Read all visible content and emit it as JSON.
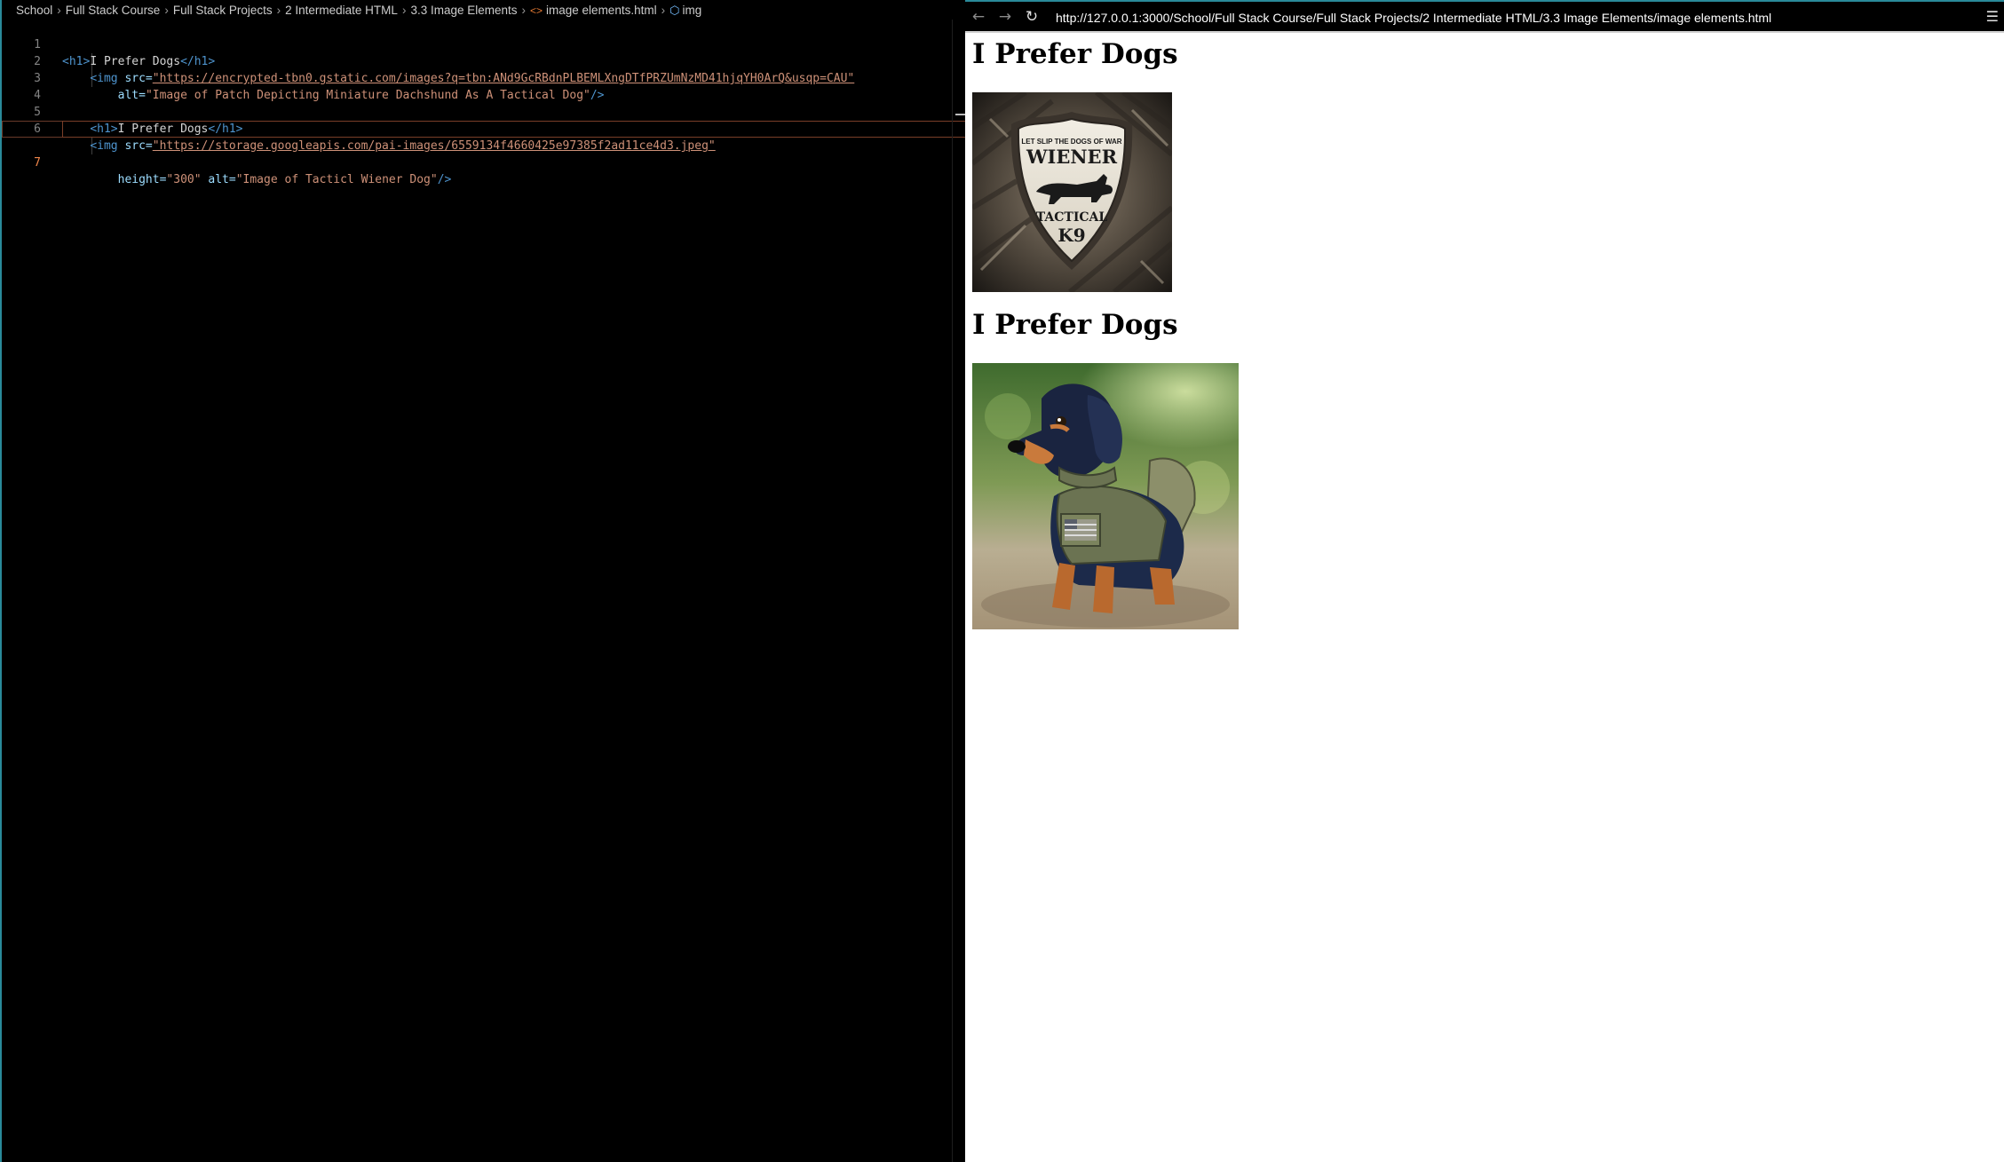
{
  "editor": {
    "breadcrumb": [
      "School",
      "Full Stack Course",
      "Full Stack Projects",
      "2 Intermediate HTML",
      "3.3 Image Elements"
    ],
    "breadcrumb_file": "image elements.html",
    "breadcrumb_symbol": "img",
    "active_line": 7,
    "lines": [
      {
        "n": "1"
      },
      {
        "n": "2"
      },
      {
        "n": "3"
      },
      {
        "n": "4"
      },
      {
        "n": "5"
      },
      {
        "n": "6"
      },
      {
        "n": "7"
      }
    ],
    "code": {
      "l1_open": "<h1>",
      "l1_text": "I Prefer Dogs",
      "l1_close": "</h1>",
      "l2_tag": "<img",
      "l2_attr": "src=",
      "l2_val": "\"https://encrypted-tbn0.gstatic.com/images?q=tbn:ANd9GcRBdnPLBEMLXngDTfPRZUmNzMD41hjqYH0ArQ&usqp=CAU\"",
      "l3_attr": "alt=",
      "l3_val": "\"Image of Patch Depicting Miniature Dachshund As A Tactical Dog\"",
      "l3_close": "/>",
      "l5_open": "<h1>",
      "l5_text": "I Prefer Dogs",
      "l5_close": "</h1>",
      "l6_tag": "<img",
      "l6_attr": "src=",
      "l6_val": "\"https://storage.googleapis.com/pai-images/6559134f4660425e97385f2ad11ce4d3.jpeg\"",
      "l7_attr1": "height=",
      "l7_val1": "\"300\"",
      "l7_attr2": "alt=",
      "l7_val2": "\"Image of Tacticl Wiener Dog\"",
      "l7_close": "/>"
    }
  },
  "browser": {
    "url": "http://127.0.0.1:3000/School/Full Stack Course/Full Stack Projects/2 Intermediate HTML/3.3 Image Elements/image elements.html",
    "heading1": "I Prefer Dogs",
    "heading2": "I Prefer Dogs",
    "image1": {
      "alt": "Image of Patch Depicting Miniature Dachshund As A Tactical Dog",
      "patch_text_top": "LET SLIP THE DOGS OF WAR",
      "patch_text_main": "WIENER",
      "patch_text_sub": "TACTICAL",
      "patch_text_k9": "K9"
    },
    "image2": {
      "alt": "Image of Tacticl Wiener Dog"
    }
  },
  "colors": {
    "accent": "#2a8a9a",
    "active_line_number": "#f0864a"
  }
}
